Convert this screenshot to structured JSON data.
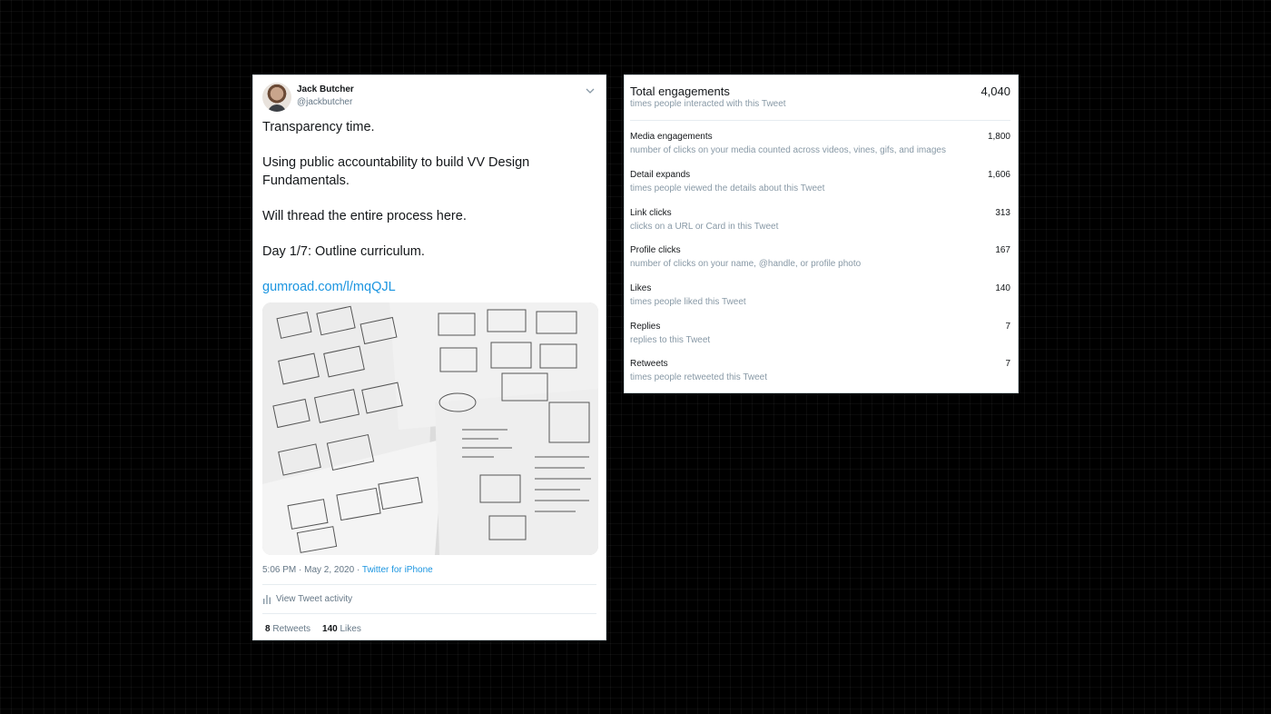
{
  "tweet": {
    "author_name": "Jack Butcher",
    "author_handle": "@jackbutcher",
    "lines": [
      "Transparency time.",
      "Using public accountability to build VV Design Fundamentals.",
      "Will thread the entire process here.",
      "Day 1/7: Outline curriculum."
    ],
    "link": "gumroad.com/l/mqQJL",
    "timestamp": "5:06 PM · May 2, 2020",
    "separator": " · ",
    "source": "Twitter for iPhone",
    "activity_label": "View Tweet activity",
    "retweets_count": "8",
    "retweets_label": "Retweets",
    "likes_count": "140",
    "likes_label": "Likes",
    "link_color": "#1b95e0",
    "icons": [
      "chevron-down-icon",
      "bar-chart-icon"
    ]
  },
  "analytics": {
    "total": {
      "label": "Total engagements",
      "description": "times people interacted with this Tweet",
      "value": "4,040"
    },
    "metrics": [
      {
        "label": "Media engagements",
        "description": "number of clicks on your media counted across videos, vines, gifs, and images",
        "value": "1,800"
      },
      {
        "label": "Detail expands",
        "description": "times people viewed the details about this Tweet",
        "value": "1,606"
      },
      {
        "label": "Link clicks",
        "description": "clicks on a URL or Card in this Tweet",
        "value": "313"
      },
      {
        "label": "Profile clicks",
        "description": "number of clicks on your name, @handle, or profile photo",
        "value": "167"
      },
      {
        "label": "Likes",
        "description": "times people liked this Tweet",
        "value": "140"
      },
      {
        "label": "Replies",
        "description": "replies to this Tweet",
        "value": "7"
      },
      {
        "label": "Retweets",
        "description": "times people retweeted this Tweet",
        "value": "7"
      }
    ]
  }
}
